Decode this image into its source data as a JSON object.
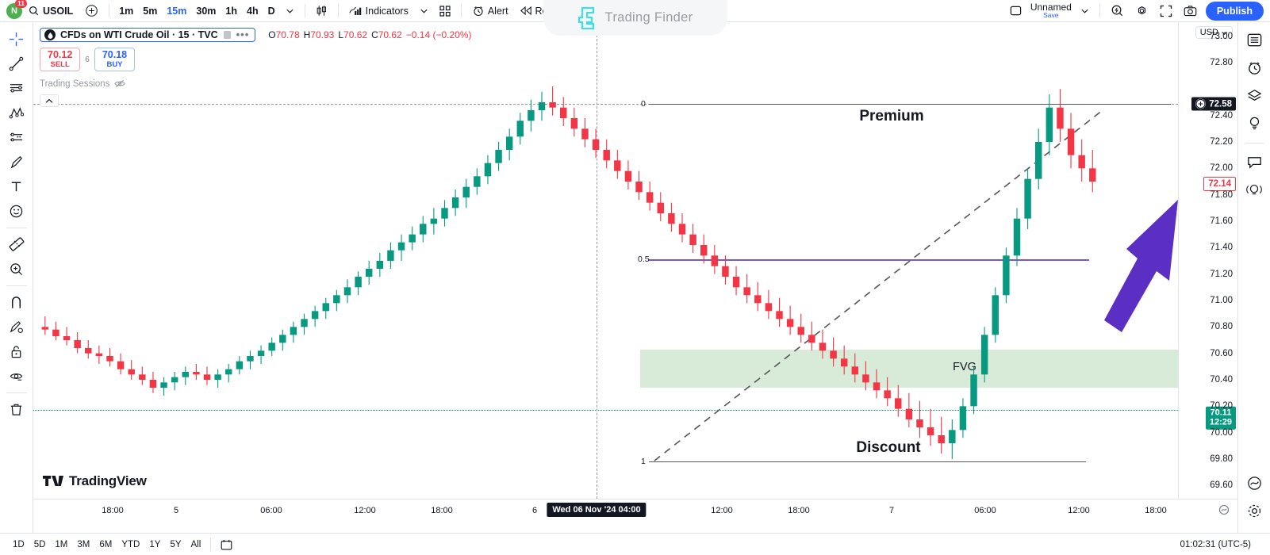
{
  "topbar": {
    "user_initial": "N",
    "notifications": "11",
    "symbol": "USOIL",
    "search_icon": "search-icon",
    "add_icon": "plus-circle-icon",
    "timeframes": [
      "1m",
      "5m",
      "15m",
      "30m",
      "1h",
      "4h",
      "D"
    ],
    "active_timeframe": "15m",
    "timeframe_chevron": "chevron-down-icon",
    "candle_type_icon": "candlestick-icon",
    "indicators_label": "Indicators",
    "indicators_chevron": "chevron-down-icon",
    "grid_icon": "layout-grid-icon",
    "alert_label": "Alert",
    "alert_icon": "alarm-plus-icon",
    "replay_label": "Replay",
    "replay_icon": "replay-icon",
    "undo_icon": "undo-arrow-icon",
    "redo_icon": "redo-arrow-icon",
    "layout_icon": "layout-square-icon",
    "unnamed_label": "Unnamed",
    "save_label": "Save",
    "unnamed_chevron": "chevron-down-icon",
    "quick_icon": "quick-search-icon",
    "settings_icon": "gear-icon",
    "fullscreen_icon": "fullscreen-icon",
    "snapshot_icon": "camera-icon",
    "publish_label": "Publish"
  },
  "watermark": {
    "text": "Trading Finder",
    "logo_icon": "trading-finder-logo-icon",
    "accent": "#2ee6e6"
  },
  "left_tools": [
    {
      "name": "cross-cursor-icon"
    },
    {
      "name": "trend-line-icon"
    },
    {
      "name": "horizontal-lines-icon"
    },
    {
      "name": "elliott-wave-icon"
    },
    {
      "name": "gann-fan-icon"
    },
    {
      "name": "brush-icon"
    },
    {
      "name": "text-tool-icon"
    },
    {
      "name": "emoji-icon"
    },
    {
      "name": "measure-ruler-icon"
    },
    {
      "name": "zoom-in-icon"
    },
    {
      "name": "magnet-icon"
    },
    {
      "name": "drawing-mode-icon"
    },
    {
      "name": "lock-drawings-icon"
    },
    {
      "name": "hide-drawings-icon"
    },
    {
      "name": "remove-drawings-icon"
    }
  ],
  "right_tools": [
    {
      "name": "watchlist-icon"
    },
    {
      "name": "alerts-clock-icon"
    },
    {
      "name": "data-window-icon"
    },
    {
      "name": "hotlist-idea-icon"
    },
    {
      "name": "chat-icon"
    },
    {
      "name": "broadcast-idea-icon"
    }
  ],
  "right_tools_bottom": [
    {
      "name": "objects-tree-icon"
    },
    {
      "name": "settings-gear-icon"
    }
  ],
  "legend": {
    "symbol_icon": "oil-drop-icon",
    "title": "CFDs on WTI Crude Oil · 15 · TVC",
    "eye_icon": "hide-series-icon",
    "more_icon": "more-options-icon",
    "ohlc": [
      {
        "label": "O",
        "value": "70.78"
      },
      {
        "label": "H",
        "value": "70.93"
      },
      {
        "label": "L",
        "value": "70.62"
      },
      {
        "label": "C",
        "value": "70.62"
      }
    ],
    "change": "−0.14 (−0.20%)",
    "change_color": "#f23645",
    "sell_price": "70.12",
    "sell_label": "SELL",
    "buy_price": "70.18",
    "buy_label": "BUY",
    "qty": "6",
    "sessions_label": "Trading Sessions",
    "sessions_icon": "eye-off-icon",
    "collapse_icon": "chevron-up-icon",
    "tv_brand": "TradingView"
  },
  "price_scale": {
    "currency": "USD",
    "currency_chevron": "chevron-down-icon",
    "ticks": [
      "73.00",
      "72.80",
      "72.40",
      "72.20",
      "72.00",
      "71.80",
      "71.60",
      "71.40",
      "71.20",
      "71.00",
      "70.80",
      "70.60",
      "70.40",
      "70.20",
      "70.00",
      "69.80",
      "69.60"
    ],
    "badge_dark": "72.58",
    "badge_dark_icon": "add-alert-icon",
    "badge_red": "72.14",
    "badge_green_price": "70.11",
    "badge_green_time": "12:29"
  },
  "time_scale": {
    "ticks": [
      "18:00",
      "5",
      "06:00",
      "12:00",
      "18:00",
      "6",
      "12:00",
      "18:00",
      "7",
      "06:00",
      "12:00",
      "18:00"
    ],
    "crosshair_label": "Wed 06 Nov '24   04:00",
    "reset_icon": "reset-chart-icon"
  },
  "drawings": {
    "premium_label": "Premium",
    "discount_label": "Discount",
    "fvg_label": "FVG",
    "level_0": "0",
    "level_half": "0.5",
    "level_1": "1",
    "fvg_color": "#d8ead8",
    "equilibrium_color": "#7b59c9",
    "arrow_color": "#5b2ec4"
  },
  "bottombar": {
    "ranges": [
      "1D",
      "5D",
      "1M",
      "3M",
      "6M",
      "YTD",
      "1Y",
      "5Y",
      "All"
    ],
    "calendar_icon": "calendar-icon",
    "clock": "01:02:31 (UTC-5)"
  },
  "chart_data": {
    "type": "candlestick",
    "title": "CFDs on WTI Crude Oil · 15 · TVC",
    "ylabel": "USD",
    "ylim": [
      69.5,
      73.1
    ],
    "up_color": "#089981",
    "down_color": "#f23645",
    "annotations": [
      {
        "text": "Premium",
        "kind": "zone-label"
      },
      {
        "text": "Discount",
        "kind": "zone-label"
      },
      {
        "text": "FVG",
        "kind": "zone-label"
      },
      {
        "text": "0",
        "kind": "fib-level"
      },
      {
        "text": "0.5",
        "kind": "fib-level"
      },
      {
        "text": "1",
        "kind": "fib-level"
      }
    ],
    "candles": [
      [
        70.8,
        70.88,
        70.74,
        70.78
      ],
      [
        70.78,
        70.84,
        70.7,
        70.73
      ],
      [
        70.73,
        70.8,
        70.66,
        70.7
      ],
      [
        70.7,
        70.76,
        70.6,
        70.64
      ],
      [
        70.64,
        70.7,
        70.56,
        70.6
      ],
      [
        70.6,
        70.66,
        70.52,
        70.58
      ],
      [
        70.58,
        70.64,
        70.5,
        70.54
      ],
      [
        70.54,
        70.6,
        70.44,
        70.48
      ],
      [
        70.48,
        70.55,
        70.4,
        70.44
      ],
      [
        70.44,
        70.5,
        70.36,
        70.4
      ],
      [
        70.4,
        70.46,
        70.3,
        70.34
      ],
      [
        70.34,
        70.42,
        70.28,
        70.38
      ],
      [
        70.38,
        70.46,
        70.32,
        70.42
      ],
      [
        70.42,
        70.5,
        70.36,
        70.46
      ],
      [
        70.46,
        70.52,
        70.4,
        70.44
      ],
      [
        70.44,
        70.5,
        70.36,
        70.4
      ],
      [
        70.4,
        70.48,
        70.34,
        70.44
      ],
      [
        70.44,
        70.52,
        70.38,
        70.48
      ],
      [
        70.48,
        70.58,
        70.44,
        70.54
      ],
      [
        70.54,
        70.62,
        70.48,
        70.58
      ],
      [
        70.58,
        70.66,
        70.52,
        70.62
      ],
      [
        70.62,
        70.72,
        70.58,
        70.68
      ],
      [
        70.68,
        70.78,
        70.62,
        70.74
      ],
      [
        70.74,
        70.84,
        70.68,
        70.8
      ],
      [
        70.8,
        70.9,
        70.74,
        70.86
      ],
      [
        70.86,
        70.96,
        70.8,
        70.92
      ],
      [
        70.92,
        71.02,
        70.86,
        70.98
      ],
      [
        70.98,
        71.08,
        70.92,
        71.04
      ],
      [
        71.04,
        71.16,
        70.98,
        71.1
      ],
      [
        71.1,
        71.22,
        71.04,
        71.18
      ],
      [
        71.18,
        71.3,
        71.12,
        71.24
      ],
      [
        71.24,
        71.36,
        71.18,
        71.3
      ],
      [
        71.3,
        71.44,
        71.24,
        71.38
      ],
      [
        71.38,
        71.5,
        71.3,
        71.44
      ],
      [
        71.44,
        71.56,
        71.38,
        71.5
      ],
      [
        71.5,
        71.64,
        71.44,
        71.58
      ],
      [
        71.58,
        71.7,
        71.5,
        71.62
      ],
      [
        71.62,
        71.76,
        71.56,
        71.7
      ],
      [
        71.7,
        71.84,
        71.64,
        71.78
      ],
      [
        71.78,
        71.92,
        71.7,
        71.86
      ],
      [
        71.86,
        72.0,
        71.8,
        71.94
      ],
      [
        71.94,
        72.1,
        71.88,
        72.04
      ],
      [
        72.04,
        72.2,
        71.98,
        72.14
      ],
      [
        72.14,
        72.3,
        72.06,
        72.24
      ],
      [
        72.24,
        72.42,
        72.18,
        72.36
      ],
      [
        72.36,
        72.52,
        72.28,
        72.44
      ],
      [
        72.44,
        72.58,
        72.36,
        72.5
      ],
      [
        72.5,
        72.62,
        72.4,
        72.46
      ],
      [
        72.46,
        72.54,
        72.32,
        72.38
      ],
      [
        72.38,
        72.46,
        72.24,
        72.3
      ],
      [
        72.3,
        72.38,
        72.16,
        72.22
      ],
      [
        72.22,
        72.3,
        72.08,
        72.14
      ],
      [
        72.14,
        72.22,
        72.0,
        72.06
      ],
      [
        72.06,
        72.14,
        71.92,
        71.98
      ],
      [
        71.98,
        72.06,
        71.84,
        71.9
      ],
      [
        71.9,
        71.98,
        71.76,
        71.82
      ],
      [
        71.82,
        71.9,
        71.68,
        71.74
      ],
      [
        71.74,
        71.82,
        71.6,
        71.66
      ],
      [
        71.66,
        71.74,
        71.52,
        71.58
      ],
      [
        71.58,
        71.66,
        71.44,
        71.5
      ],
      [
        71.5,
        71.58,
        71.36,
        71.42
      ],
      [
        71.42,
        71.5,
        71.28,
        71.34
      ],
      [
        71.34,
        71.42,
        71.2,
        71.26
      ],
      [
        71.26,
        71.34,
        71.12,
        71.18
      ],
      [
        71.18,
        71.26,
        71.04,
        71.1
      ],
      [
        71.1,
        71.2,
        70.98,
        71.04
      ],
      [
        71.04,
        71.14,
        70.92,
        70.98
      ],
      [
        70.98,
        71.08,
        70.86,
        70.92
      ],
      [
        70.92,
        71.02,
        70.8,
        70.86
      ],
      [
        70.86,
        70.96,
        70.74,
        70.8
      ],
      [
        70.8,
        70.9,
        70.68,
        70.74
      ],
      [
        70.74,
        70.84,
        70.62,
        70.68
      ],
      [
        70.68,
        70.78,
        70.56,
        70.62
      ],
      [
        70.62,
        70.72,
        70.5,
        70.56
      ],
      [
        70.56,
        70.66,
        70.44,
        70.5
      ],
      [
        70.5,
        70.6,
        70.38,
        70.44
      ],
      [
        70.44,
        70.54,
        70.32,
        70.38
      ],
      [
        70.38,
        70.48,
        70.26,
        70.32
      ],
      [
        70.32,
        70.42,
        70.2,
        70.26
      ],
      [
        70.26,
        70.36,
        70.12,
        70.18
      ],
      [
        70.18,
        70.3,
        70.04,
        70.1
      ],
      [
        70.1,
        70.24,
        69.96,
        70.04
      ],
      [
        70.04,
        70.18,
        69.9,
        69.98
      ],
      [
        69.98,
        70.12,
        69.84,
        69.92
      ],
      [
        69.92,
        70.1,
        69.8,
        70.02
      ],
      [
        70.02,
        70.26,
        69.96,
        70.2
      ],
      [
        70.2,
        70.5,
        70.14,
        70.44
      ],
      [
        70.44,
        70.8,
        70.38,
        70.74
      ],
      [
        70.74,
        71.1,
        70.68,
        71.04
      ],
      [
        71.04,
        71.4,
        70.98,
        71.34
      ],
      [
        71.34,
        71.7,
        71.26,
        71.62
      ],
      [
        71.62,
        72.0,
        71.54,
        71.92
      ],
      [
        71.92,
        72.3,
        71.84,
        72.2
      ],
      [
        72.2,
        72.56,
        72.1,
        72.46
      ],
      [
        72.46,
        72.6,
        72.2,
        72.3
      ],
      [
        72.3,
        72.42,
        72.0,
        72.1
      ],
      [
        72.1,
        72.22,
        71.9,
        72.0
      ],
      [
        72.0,
        72.14,
        71.82,
        71.9
      ]
    ]
  }
}
